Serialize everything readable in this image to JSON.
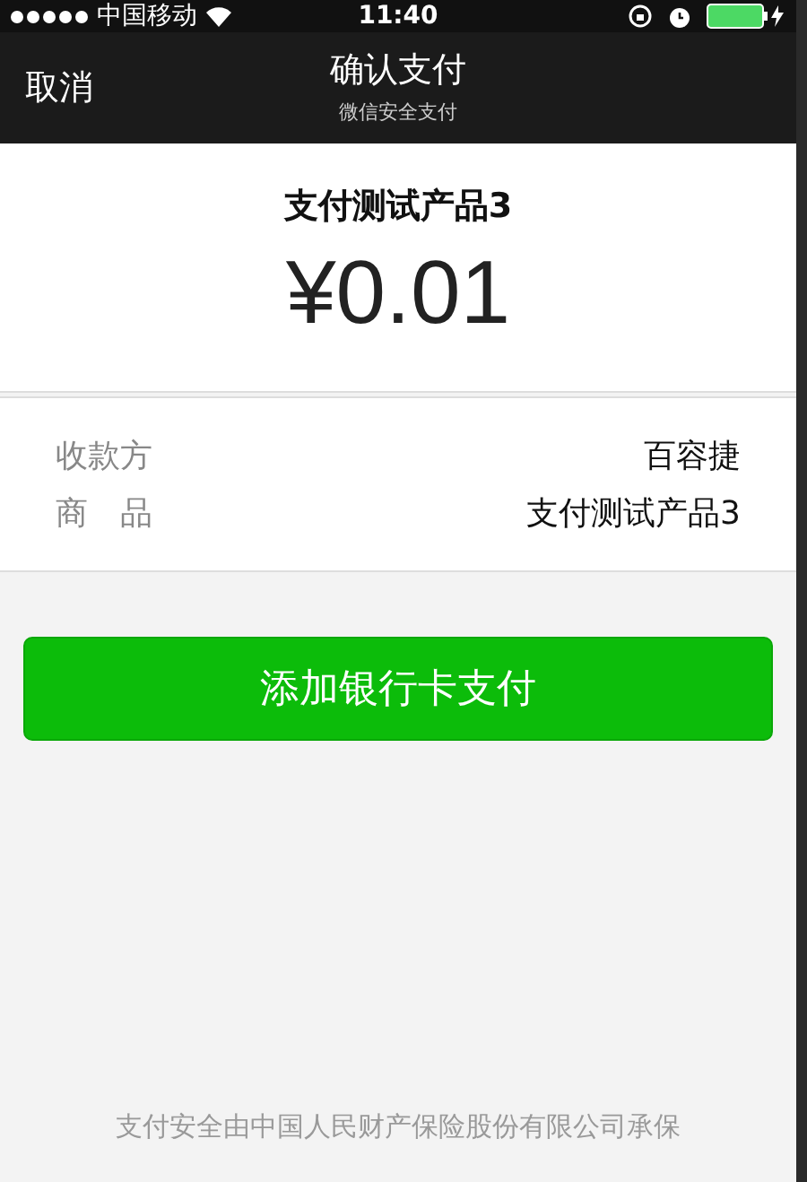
{
  "status_bar": {
    "carrier": "中国移动",
    "time": "11:40"
  },
  "nav": {
    "back": "取消",
    "title": "确认支付",
    "subtitle": "微信安全支付"
  },
  "order": {
    "product": "支付测试产品3",
    "amount": "¥0.01"
  },
  "details": [
    {
      "label": "收款方",
      "value": "百容捷"
    },
    {
      "label": "商　品",
      "value": "支付测试产品3"
    }
  ],
  "pay_button": "添加银行卡支付",
  "footer": "支付安全由中国人民财产保险股份有限公司承保"
}
